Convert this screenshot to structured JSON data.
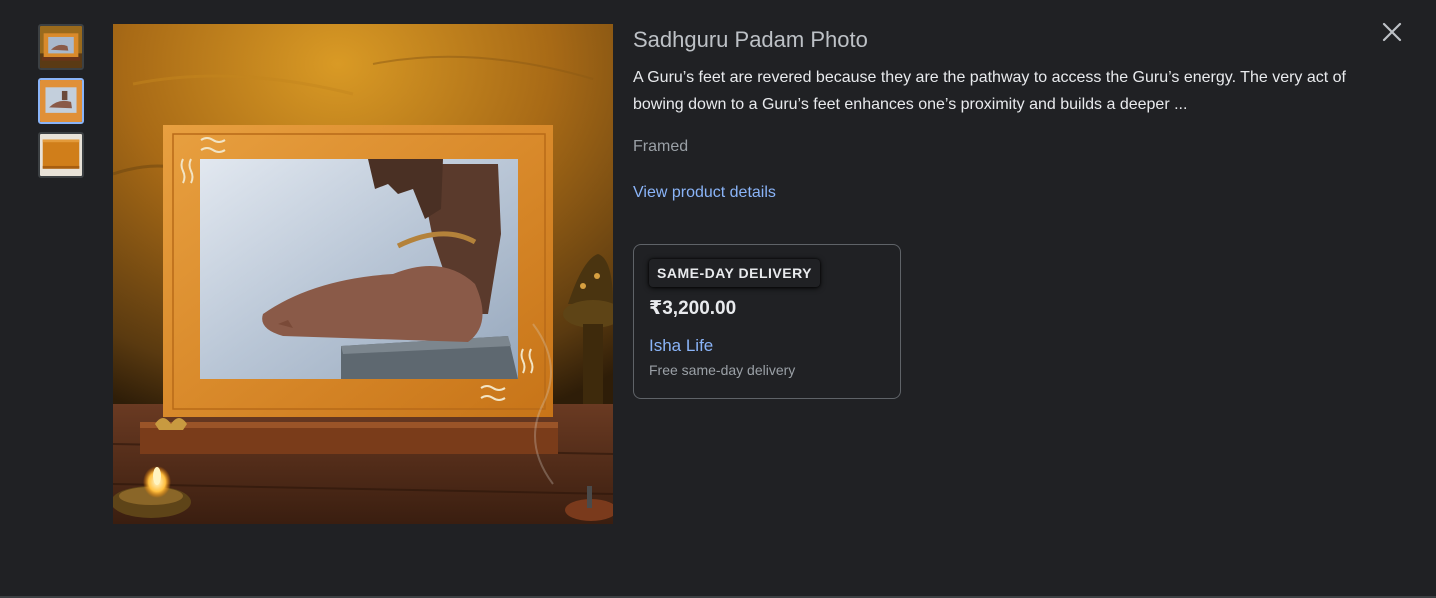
{
  "product": {
    "title": "Sadhguru Padam Photo",
    "description": "A Guru’s feet are revered because they are the pathway to access the Guru’s energy. The very act of bowing down to a Guru’s feet enhances one’s proximity and builds a deeper ...",
    "variant": "Framed",
    "details_link": "View product details"
  },
  "offer": {
    "badge": "SAME-DAY DELIVERY",
    "price": "₹3,200.00",
    "seller": "Isha Life",
    "delivery_note": "Free same-day delivery"
  },
  "icons": {
    "close": "close-icon"
  },
  "colors": {
    "background": "#202124",
    "link": "#8ab4f8",
    "frame_wood": "#d98a2b"
  }
}
